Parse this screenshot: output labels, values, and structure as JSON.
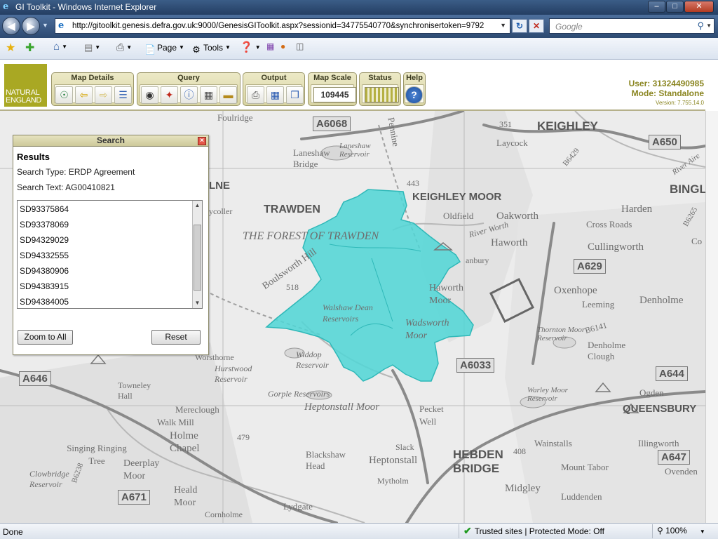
{
  "window": {
    "title": "GI Toolkit - Windows Internet Explorer",
    "buttons": {
      "minimize": "–",
      "maximize": "□",
      "close": "✕"
    }
  },
  "address": {
    "url": "http://gitoolkit.genesis.defra.gov.uk:9000/GenesisGIToolkit.aspx?sessionid=34775540770&synchronisertoken=9792",
    "search_placeholder": "Google"
  },
  "command_bar": {
    "page_label": "Page",
    "tools_label": "Tools"
  },
  "app": {
    "logo": {
      "line1": "NATURAL",
      "line2": "ENGLAND"
    },
    "groups": {
      "map_details": "Map Details",
      "query": "Query",
      "output": "Output",
      "map_scale": "Map Scale",
      "status": "Status",
      "help": "Help"
    },
    "map_scale_value": "109445",
    "user_label": "User: 31324490985",
    "mode_label": "Mode: Standalone",
    "version_label": "Version: 7.755.14.0"
  },
  "search_panel": {
    "title": "Search",
    "heading": "Results",
    "search_type": "Search Type: ERDP Agreement",
    "search_text": "Search Text: AG00410821",
    "results": [
      "SD93375864",
      "SD93378069",
      "SD94329029",
      "SD94332555",
      "SD94380906",
      "SD94383915",
      "SD94384005"
    ],
    "zoom_button": "Zoom to All",
    "reset_button": "Reset"
  },
  "map": {
    "highlight_color": "#4fd6d6",
    "labels": {
      "keighley": "KEIGHLEY",
      "keighley_moor": "KEIGHLEY MOOR",
      "trawden": "TRAWDEN",
      "forest_of_trawden": "THE FOREST OF TRAWDEN",
      "laneshaw_bridge": "Laneshaw Bridge",
      "laneshaw_reservoir": "Laneshaw Reservoir",
      "foulridge": "Foulridge",
      "laycock": "Laycock",
      "oldfield": "Oldfield",
      "oakworth": "Oakworth",
      "haworth": "Haworth",
      "harden": "Harden",
      "cross_roads": "Cross Roads",
      "cullingworth": "Cullingworth",
      "bingley": "BINGL",
      "oxenhope": "Oxenhope",
      "leeming": "Leeming",
      "denholme": "Denholme",
      "denholme_clough": "Denholme Clough",
      "thornton_moor": "Thornton Moor Reservoir",
      "boulsworth_hill": "Boulsworth Hill",
      "walshaw_dean": "Walshaw Dean Reservoirs",
      "wadsworth_moor": "Wadsworth Moor",
      "haworth_moor": "Haworth Moor",
      "widdop": "Widdop Reservoir",
      "hurstwood": "Hurstwood Reservoir",
      "worsthorne": "Worsthorne",
      "gorple": "Gorple Reservoirs",
      "heptonstall_moor": "Heptonstall Moor",
      "heptonstall": "Heptonstall",
      "hebden_bridge": "HEBDEN BRIDGE",
      "pecket_well": "Pecket Well",
      "slack": "Slack",
      "blackshaw_head": "Blackshaw Head",
      "mytholm": "Mytholm",
      "midgley": "Midgley",
      "luddenden": "Luddenden",
      "mount_tabor": "Mount Tabor",
      "wainstalls": "Wainstalls",
      "warley_moor": "Warley Moor Reservoir",
      "queensbury": "QUEENSBURY",
      "ogden": "Ogden",
      "ovenden": "Ovenden",
      "illingworth": "Illingworth",
      "towneley": "Towneley Hall",
      "mereclough": "Mereclough",
      "walk_mill": "Walk Mill",
      "holme_chapel": "Holme Chapel",
      "singing_ringing": "Singing Ringing Tree",
      "deerplay": "Deerplay Moor",
      "clowbridge": "Clowbridge Reservoir",
      "heald_moor": "Heald Moor",
      "lydgate": "Lydgate",
      "cornholme": "Cornholme",
      "colne": "LNE",
      "trawden_cycller": "ycoller",
      "pennine_way": "Pennine",
      "river_worth": "River Worth",
      "river_aire": "River Aire",
      "spot_443": "443",
      "spot_518": "518",
      "spot_351": "351",
      "spot_479": "479",
      "spot_408": "408",
      "stanbury": "anbury",
      "cop": "Co"
    },
    "roads": {
      "a6068": "A6068",
      "a650": "A650",
      "a629": "A629",
      "a6033": "A6033",
      "a646": "A646",
      "a644": "A644",
      "a647": "A647",
      "a671": "A671",
      "b6141": "B6141",
      "b6238": "B6238",
      "b6429": "B6429",
      "b6265": "B6265"
    }
  },
  "statusbar": {
    "done": "Done",
    "zone": "Trusted sites | Protected Mode: Off",
    "zoom": "100%"
  }
}
